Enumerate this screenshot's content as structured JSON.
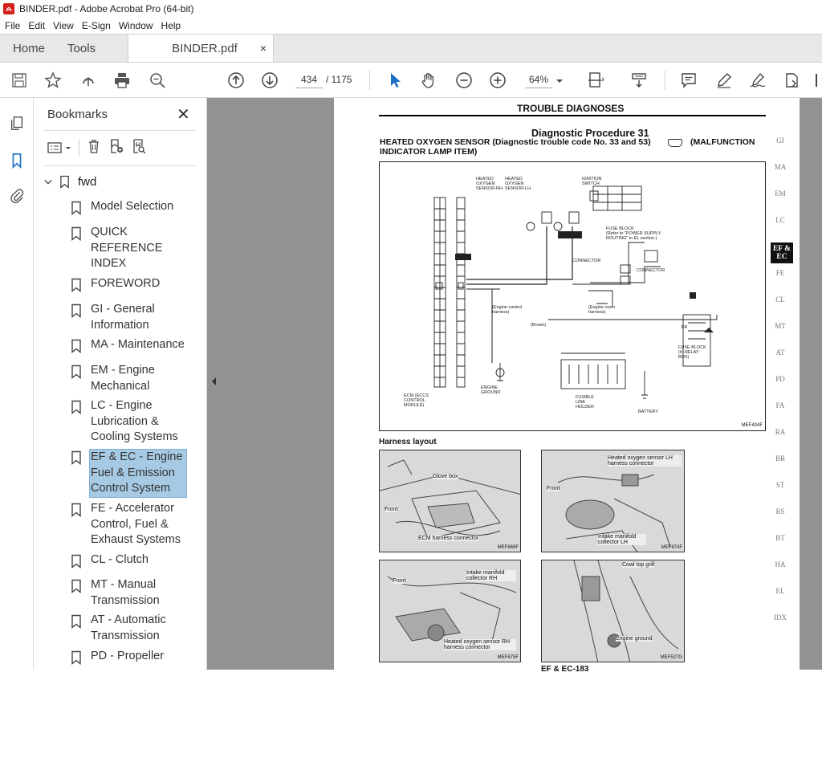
{
  "window": {
    "title": "BINDER.pdf - Adobe Acrobat Pro (64-bit)"
  },
  "menu": [
    "File",
    "Edit",
    "View",
    "E-Sign",
    "Window",
    "Help"
  ],
  "tabs": {
    "home": "Home",
    "tools": "Tools",
    "document": "BINDER.pdf",
    "close": "×"
  },
  "toolbar": {
    "page_current": "434",
    "page_total": "/ 1175",
    "zoom": "64%"
  },
  "bookmarks": {
    "header": "Bookmarks",
    "close": "✕",
    "root": "fwd",
    "items": [
      {
        "label": "Model Selection"
      },
      {
        "label": "QUICK REFERENCE INDEX"
      },
      {
        "label": "FOREWORD"
      },
      {
        "label": "GI - General Information"
      },
      {
        "label": "MA - Maintenance"
      },
      {
        "label": "EM - Engine Mechanical"
      },
      {
        "label": "LC - Engine Lubrication & Cooling Systems"
      },
      {
        "label": "EF & EC - Engine Fuel & Emission Control System",
        "selected": true
      },
      {
        "label": "FE - Accelerator Control, Fuel & Exhaust Systems"
      },
      {
        "label": "CL - Clutch"
      },
      {
        "label": "MT - Manual Transmission"
      },
      {
        "label": "AT - Automatic Transmission"
      },
      {
        "label": "PD - Propeller"
      }
    ]
  },
  "document": {
    "header": "TROUBLE DIAGNOSES",
    "procedure": "Diagnostic Procedure 31",
    "subtitle_1": "HEATED OXYGEN SENSOR (Diagnostic trouble code No. 33 and 53)",
    "subtitle_suffix": "(MALFUNCTION",
    "subtitle_2": "INDICATOR LAMP ITEM)",
    "diagram_ref": "MEF404F",
    "harness_title": "Harness layout",
    "photos": [
      {
        "labels": [
          "Glove box",
          "Front",
          "ECM harness connector"
        ],
        "ref": "MEF869F"
      },
      {
        "labels": [
          "Heated oxygen sensor LH harness connector",
          "Front",
          "Intake manifold collector LH"
        ],
        "ref": "MEF874F"
      },
      {
        "labels": [
          "Front",
          "Intake manifold collector RH",
          "Heated oxygen sensor RH harness connector"
        ],
        "ref": "MEF875F"
      },
      {
        "labels": [
          "Cowl top grill",
          "Engine ground"
        ],
        "ref": "MEF527G"
      }
    ],
    "footer": "EF & EC-183",
    "side_tabs": [
      "GI",
      "MA",
      "EM",
      "LC",
      "EF & EC",
      "FE",
      "CL",
      "MT",
      "AT",
      "PD",
      "FA",
      "RA",
      "BR",
      "ST",
      "RS",
      "BT",
      "HA",
      "EL",
      "IDX"
    ],
    "active_side_tab": "EF & EC"
  },
  "colors": {
    "pdf_red": "#d4211b",
    "selection": "#a7cae4",
    "doc_bg": "#929292",
    "link_blue": "#1a6ec8"
  }
}
